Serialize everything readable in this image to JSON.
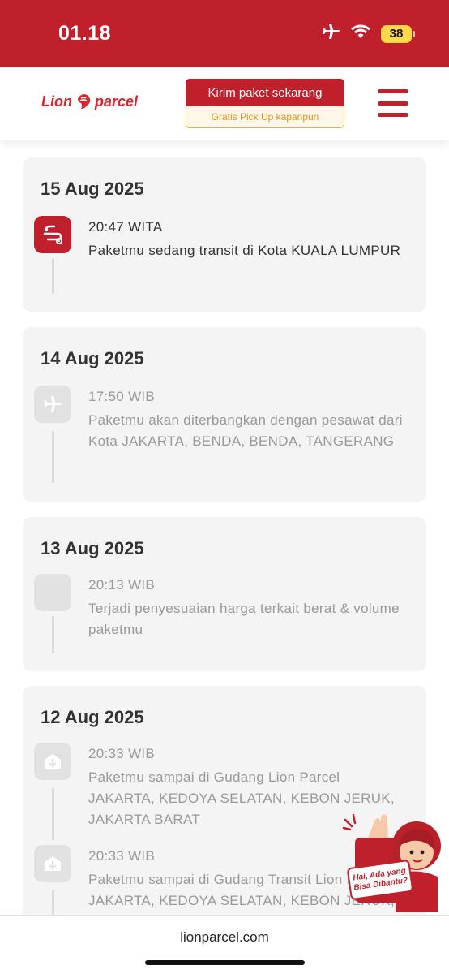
{
  "status_bar": {
    "time": "01.18",
    "battery": "38"
  },
  "header": {
    "logo_left": "Lion",
    "logo_right": "parcel",
    "cta_label": "Kirim paket sekarang",
    "cta_sub": "Gratis Pick Up kapanpun"
  },
  "timeline": [
    {
      "date": "15 Aug 2025",
      "events": [
        {
          "time": "20:47 WITA",
          "text": "Paketmu sedang transit di Kota KUALA LUMPUR",
          "icon": "transit-icon"
        }
      ]
    },
    {
      "date": "14 Aug 2025",
      "events": [
        {
          "time": "17:50 WIB",
          "text": "Paketmu akan diterbangkan dengan pesawat dari Kota JAKARTA, BENDA, BENDA, TANGERANG",
          "icon": "airplane-icon"
        }
      ]
    },
    {
      "date": "13 Aug 2025",
      "events": [
        {
          "time": "20:13 WIB",
          "text": "Terjadi penyesuaian harga terkait berat & volume paketmu",
          "icon": "blank-icon"
        }
      ]
    },
    {
      "date": "12 Aug 2025",
      "events": [
        {
          "time": "20:33 WIB",
          "text": "Paketmu sampai di Gudang Lion Parcel JAKARTA, KEDOYA SELATAN, KEBON JERUK, JAKARTA BARAT",
          "icon": "warehouse-icon"
        },
        {
          "time": "20:33 WIB",
          "text": "Paketmu sampai di Gudang Transit Lion Parcel JAKARTA, KEDOYA SELATAN, KEBON JERUK, JAKARTA BARAT",
          "icon": "warehouse-icon"
        }
      ]
    }
  ],
  "helper": {
    "bubble_line1": "Hai, Ada yang",
    "bubble_line2": "Bisa Dibantu?"
  },
  "footer": {
    "url": "lionparcel.com"
  },
  "colors": {
    "brand_red": "#c0202b",
    "cta_orange": "#f0a93a",
    "card_bg": "#f4f4f4"
  }
}
